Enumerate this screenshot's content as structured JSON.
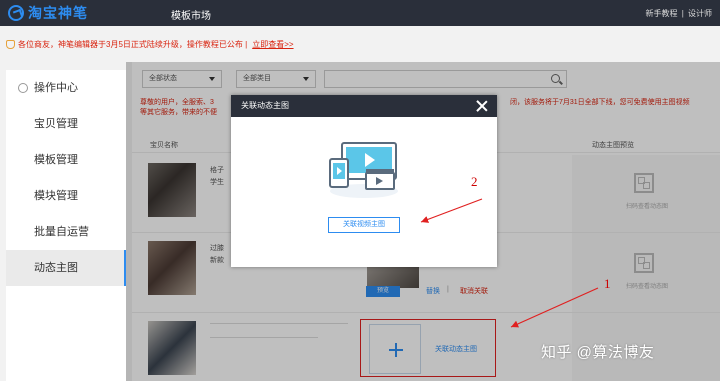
{
  "header": {
    "logo_text": "淘宝神笔",
    "nav_template_market": "模板市场",
    "link_tutorial": "新手教程",
    "link_separator": "|",
    "link_designer": "设计师"
  },
  "notice": {
    "text": "各位商友，神笔编辑器于3月5日正式陆续升级，操作教程已公布 |",
    "link": "立即查看>>"
  },
  "sidebar": {
    "items": [
      {
        "label": "操作中心"
      },
      {
        "label": "宝贝管理"
      },
      {
        "label": "模板管理"
      },
      {
        "label": "模块管理"
      },
      {
        "label": "批量自运营"
      },
      {
        "label": "动态主图"
      }
    ]
  },
  "filters": {
    "status_value": "全部状态",
    "category_value": "全部类目",
    "search_placeholder": ""
  },
  "tip": {
    "line1_left": "尊敬的用户，全服索、3",
    "line1_right": "闭，该服务将于7月31日全部下线，您可免费使用主图视频",
    "line2": "等其它服务，带来的不便"
  },
  "table": {
    "col_item_name": "宝贝名称",
    "col_preview": "动态主图预览",
    "rows": [
      {
        "title_a": "格子",
        "title_b": "学生",
        "qr_label": "扫码查看动态图"
      },
      {
        "title_a": "过膝",
        "title_b": "新款",
        "qr_label": "扫码查看动态图"
      }
    ],
    "preview_btn": "预览",
    "replace_link": "替换",
    "separator": "|",
    "cancel_link": "取消关联",
    "add_label": "关联动态主图"
  },
  "modal": {
    "title": "关联动态主图",
    "button": "关联视频主图"
  },
  "annotations": {
    "num_1": "1",
    "num_2": "2"
  },
  "watermark": "知乎 @算法博友",
  "colors": {
    "topbar": "#2a2f3a",
    "accent": "#2d8cf0",
    "alert": "#d9230f",
    "annotation_red": "#e02020"
  }
}
